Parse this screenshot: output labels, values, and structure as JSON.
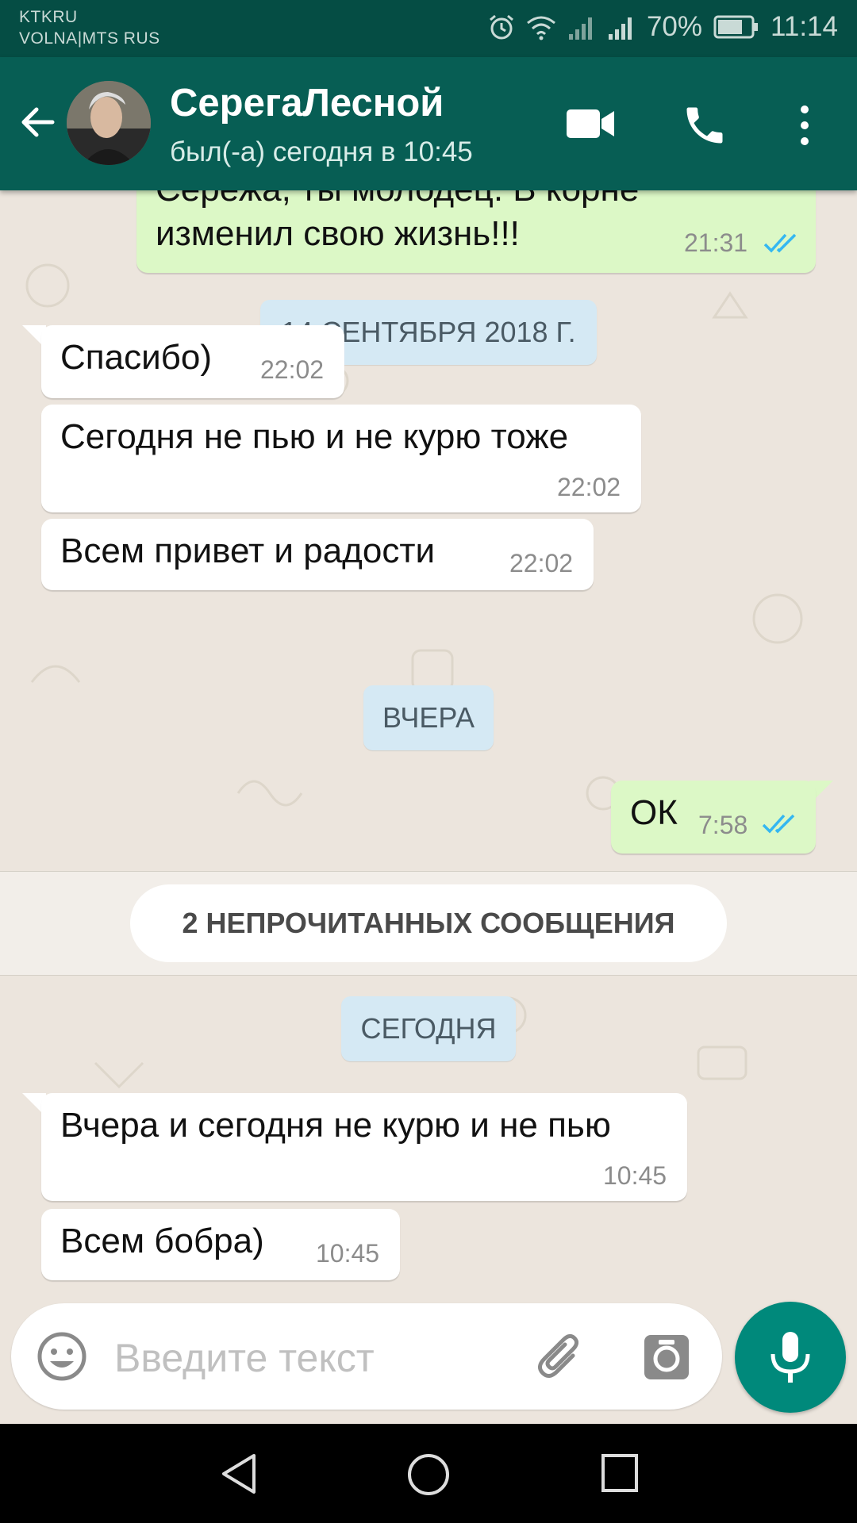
{
  "status_bar": {
    "carrier_1": "KTKRU",
    "carrier_2": "VOLNA|MTS RUS",
    "battery": "70%",
    "time": "11:14",
    "icons": [
      "alarm-icon",
      "wifi-icon",
      "signal-icon",
      "roaming-signal-icon",
      "battery-icon"
    ]
  },
  "header": {
    "contact_name": "СерегаЛесной",
    "last_seen": "был(-а) сегодня в 10:45",
    "icons": [
      "back-arrow-icon",
      "video-call-icon",
      "phone-call-icon",
      "more-options-icon"
    ]
  },
  "messages": [
    {
      "direction": "out",
      "text_1": "Сережа, ты молодец. В корне",
      "text_2": "изменил свою жизнь!!!",
      "time": "21:31",
      "read": true
    },
    {
      "type": "date",
      "text": "14 СЕНТЯБРЯ 2018 Г."
    },
    {
      "direction": "in",
      "text": "Спасибо)",
      "time": "22:02"
    },
    {
      "direction": "in",
      "text": "Сегодня не пью и не курю тоже",
      "time": "22:02"
    },
    {
      "direction": "in",
      "text": "Всем привет и радости",
      "time": "22:02"
    },
    {
      "type": "date",
      "text": "ВЧЕРА"
    },
    {
      "direction": "out",
      "text": "ОК",
      "time": "7:58",
      "read": true
    },
    {
      "type": "unread",
      "text": "2 НЕПРОЧИТАННЫХ СООБЩЕНИЯ"
    },
    {
      "type": "date",
      "text": "СЕГОДНЯ"
    },
    {
      "direction": "in",
      "text": "Вчера и сегодня не курю и не пью",
      "time": "10:45"
    },
    {
      "direction": "in",
      "text": "Всем бобра)",
      "time": "10:45"
    }
  ],
  "composer": {
    "placeholder": "Введите текст",
    "icons": [
      "emoji-icon",
      "attach-icon",
      "camera-icon",
      "mic-icon"
    ]
  },
  "colors": {
    "status_bar": "#054D44",
    "app_bar": "#075E54",
    "outgoing_bubble": "#DCF8C6",
    "incoming_bubble": "#FFFFFF",
    "date_chip": "#D5E9F4",
    "mic_button": "#00897B",
    "read_ticks": "#34B7F1",
    "chat_bg": "#ECE5DD"
  },
  "nav_bar": {
    "icons": [
      "back-triangle-icon",
      "home-circle-icon",
      "recents-square-icon"
    ]
  }
}
